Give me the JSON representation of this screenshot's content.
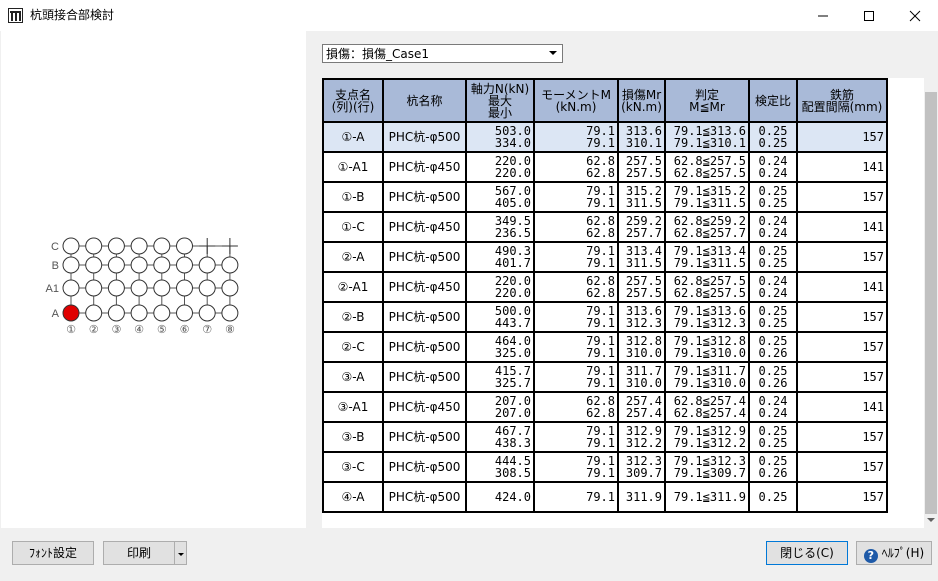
{
  "window": {
    "title": "杭頭接合部検討"
  },
  "toolbar": {
    "case_select": "損傷：損傷_Case1"
  },
  "pile_plan": {
    "row_labels": [
      "C",
      "B",
      "A1",
      "A"
    ],
    "col_labels": [
      "①",
      "②",
      "③",
      "④",
      "⑤",
      "⑥",
      "⑦",
      "⑧"
    ],
    "selected": "①-A",
    "accent_color": "#e00000"
  },
  "table": {
    "headers": {
      "support": "支点名\n(列)(行)",
      "pile": "杭名称",
      "axial": "軸力N(kN)\n最大\n最小",
      "moment": "モーメントM\n(kN.m)",
      "mr": "損傷Mr\n(kN.m)",
      "judge": "判定\nM≦Mr",
      "ratio": "検定比",
      "rebar": "鉄筋\n配置間隔(mm)"
    },
    "rows": [
      {
        "support": "①-A",
        "pile": "PHC杭-φ500",
        "n_max": "503.0",
        "n_min": "334.0",
        "m1": "79.1",
        "m2": "79.1",
        "mr1": "313.6",
        "mr2": "310.1",
        "j1": "79.1≦313.6",
        "j2": "79.1≦310.1",
        "r1": "0.25",
        "r2": "0.25",
        "rebar": "157"
      },
      {
        "support": "①-A1",
        "pile": "PHC杭-φ450",
        "n_max": "220.0",
        "n_min": "220.0",
        "m1": "62.8",
        "m2": "62.8",
        "mr1": "257.5",
        "mr2": "257.5",
        "j1": "62.8≦257.5",
        "j2": "62.8≦257.5",
        "r1": "0.24",
        "r2": "0.24",
        "rebar": "141"
      },
      {
        "support": "①-B",
        "pile": "PHC杭-φ500",
        "n_max": "567.0",
        "n_min": "405.0",
        "m1": "79.1",
        "m2": "79.1",
        "mr1": "315.2",
        "mr2": "311.5",
        "j1": "79.1≦315.2",
        "j2": "79.1≦311.5",
        "r1": "0.25",
        "r2": "0.25",
        "rebar": "157"
      },
      {
        "support": "①-C",
        "pile": "PHC杭-φ450",
        "n_max": "349.5",
        "n_min": "236.5",
        "m1": "62.8",
        "m2": "62.8",
        "mr1": "259.2",
        "mr2": "257.7",
        "j1": "62.8≦259.2",
        "j2": "62.8≦257.7",
        "r1": "0.24",
        "r2": "0.24",
        "rebar": "141"
      },
      {
        "support": "②-A",
        "pile": "PHC杭-φ500",
        "n_max": "490.3",
        "n_min": "401.7",
        "m1": "79.1",
        "m2": "79.1",
        "mr1": "313.4",
        "mr2": "311.5",
        "j1": "79.1≦313.4",
        "j2": "79.1≦311.5",
        "r1": "0.25",
        "r2": "0.25",
        "rebar": "157"
      },
      {
        "support": "②-A1",
        "pile": "PHC杭-φ450",
        "n_max": "220.0",
        "n_min": "220.0",
        "m1": "62.8",
        "m2": "62.8",
        "mr1": "257.5",
        "mr2": "257.5",
        "j1": "62.8≦257.5",
        "j2": "62.8≦257.5",
        "r1": "0.24",
        "r2": "0.24",
        "rebar": "141"
      },
      {
        "support": "②-B",
        "pile": "PHC杭-φ500",
        "n_max": "500.0",
        "n_min": "443.7",
        "m1": "79.1",
        "m2": "79.1",
        "mr1": "313.6",
        "mr2": "312.3",
        "j1": "79.1≦313.6",
        "j2": "79.1≦312.3",
        "r1": "0.25",
        "r2": "0.25",
        "rebar": "157"
      },
      {
        "support": "②-C",
        "pile": "PHC杭-φ500",
        "n_max": "464.0",
        "n_min": "325.0",
        "m1": "79.1",
        "m2": "79.1",
        "mr1": "312.8",
        "mr2": "310.0",
        "j1": "79.1≦312.8",
        "j2": "79.1≦310.0",
        "r1": "0.25",
        "r2": "0.26",
        "rebar": "157"
      },
      {
        "support": "③-A",
        "pile": "PHC杭-φ500",
        "n_max": "415.7",
        "n_min": "325.7",
        "m1": "79.1",
        "m2": "79.1",
        "mr1": "311.7",
        "mr2": "310.0",
        "j1": "79.1≦311.7",
        "j2": "79.1≦310.0",
        "r1": "0.25",
        "r2": "0.26",
        "rebar": "157"
      },
      {
        "support": "③-A1",
        "pile": "PHC杭-φ450",
        "n_max": "207.0",
        "n_min": "207.0",
        "m1": "62.8",
        "m2": "62.8",
        "mr1": "257.4",
        "mr2": "257.4",
        "j1": "62.8≦257.4",
        "j2": "62.8≦257.4",
        "r1": "0.24",
        "r2": "0.24",
        "rebar": "141"
      },
      {
        "support": "③-B",
        "pile": "PHC杭-φ500",
        "n_max": "467.7",
        "n_min": "438.3",
        "m1": "79.1",
        "m2": "79.1",
        "mr1": "312.9",
        "mr2": "312.2",
        "j1": "79.1≦312.9",
        "j2": "79.1≦312.2",
        "r1": "0.25",
        "r2": "0.25",
        "rebar": "157"
      },
      {
        "support": "③-C",
        "pile": "PHC杭-φ500",
        "n_max": "444.5",
        "n_min": "308.5",
        "m1": "79.1",
        "m2": "79.1",
        "mr1": "312.3",
        "mr2": "309.7",
        "j1": "79.1≦312.3",
        "j2": "79.1≦309.7",
        "r1": "0.25",
        "r2": "0.26",
        "rebar": "157"
      },
      {
        "support": "④-A",
        "pile": "PHC杭-φ500",
        "n_max": "424.0",
        "n_min": "",
        "m1": "79.1",
        "m2": "",
        "mr1": "311.9",
        "mr2": "",
        "j1": "79.1≦311.9",
        "j2": "",
        "r1": "0.25",
        "r2": "",
        "rebar": "157"
      }
    ]
  },
  "buttons": {
    "font": "ﾌｫﾝﾄ設定",
    "print": "印刷",
    "close": "閉じる(C)",
    "help": "ﾍﾙﾌﾟ(H)",
    "help_mark": "?"
  }
}
